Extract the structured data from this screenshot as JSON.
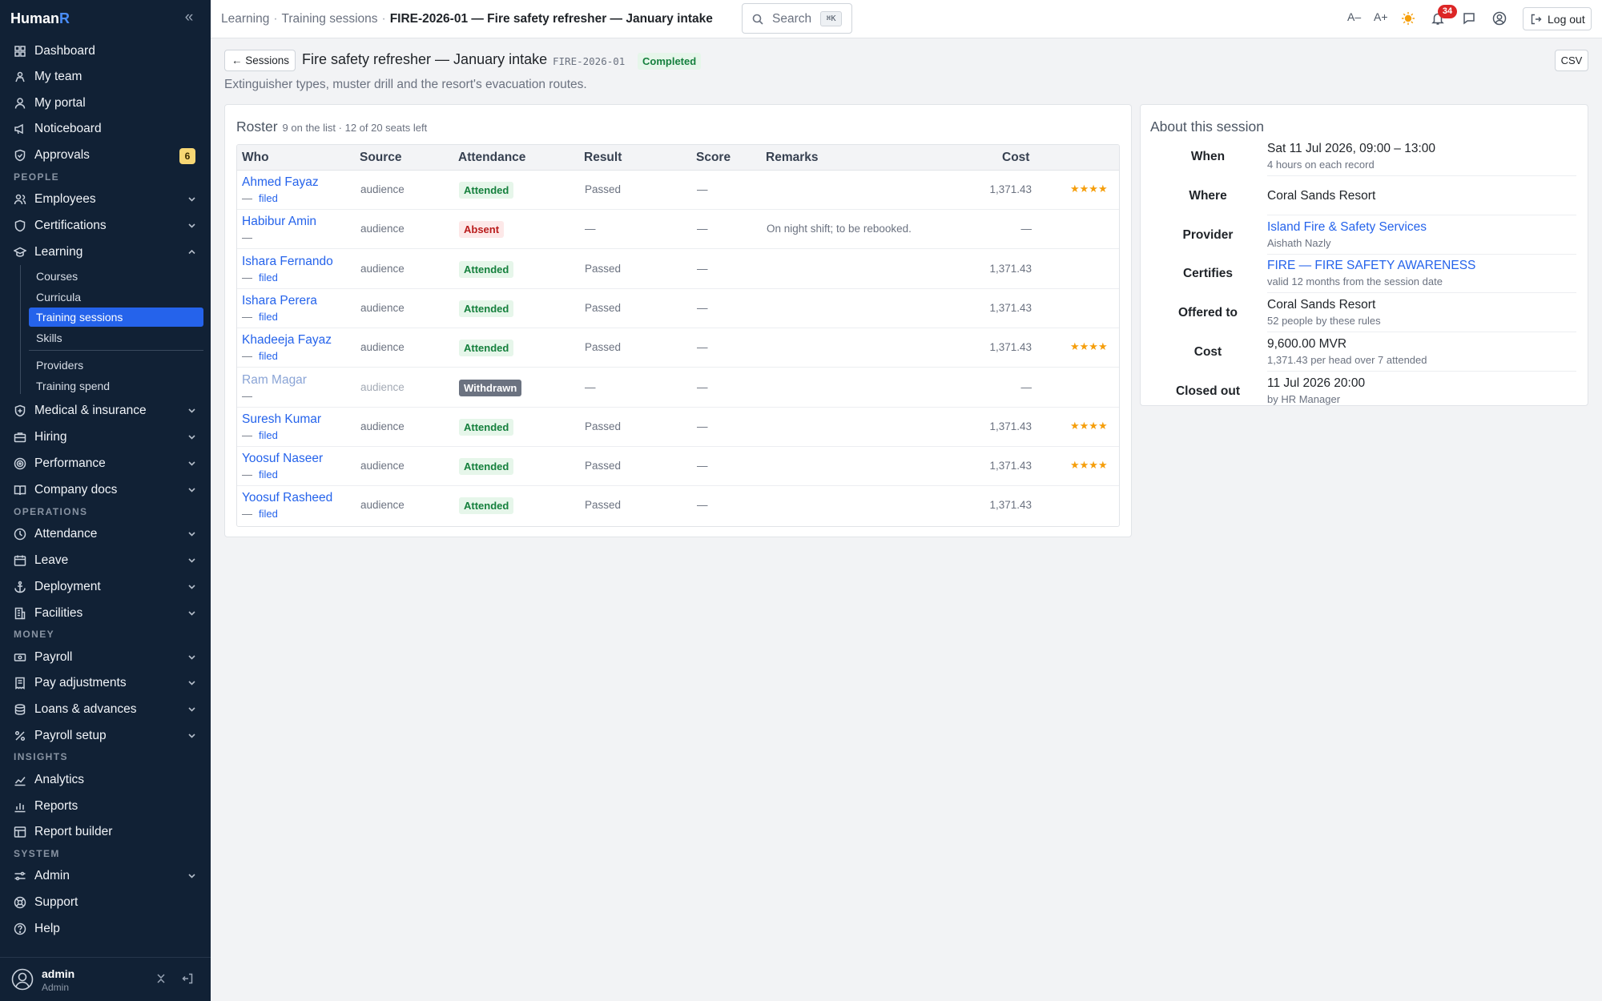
{
  "app": {
    "brand_main": "Human",
    "brand_accent": "R"
  },
  "sidebar": {
    "top_items": [
      {
        "label": "Dashboard",
        "icon": "grid-icon"
      },
      {
        "label": "My team",
        "icon": "team-icon"
      },
      {
        "label": "My portal",
        "icon": "user-icon"
      },
      {
        "label": "Noticeboard",
        "icon": "megaphone-icon"
      },
      {
        "label": "Approvals",
        "icon": "shield-check-icon",
        "badge": "6"
      }
    ],
    "sections": {
      "people": "PEOPLE",
      "operations": "OPERATIONS",
      "money": "MONEY",
      "insights": "INSIGHTS",
      "system": "SYSTEM"
    },
    "people_items": [
      {
        "label": "Employees"
      },
      {
        "label": "Certifications"
      },
      {
        "label": "Learning"
      }
    ],
    "learning_sub": [
      "Courses",
      "Curricula",
      "Training sessions",
      "Skills",
      "Providers",
      "Training spend"
    ],
    "people_items_after": [
      {
        "label": "Medical & insurance"
      },
      {
        "label": "Hiring"
      },
      {
        "label": "Performance"
      },
      {
        "label": "Company docs"
      }
    ],
    "operations_items": [
      {
        "label": "Attendance"
      },
      {
        "label": "Leave"
      },
      {
        "label": "Deployment"
      },
      {
        "label": "Facilities"
      }
    ],
    "money_items": [
      {
        "label": "Payroll"
      },
      {
        "label": "Pay adjustments"
      },
      {
        "label": "Loans & advances"
      },
      {
        "label": "Payroll setup"
      }
    ],
    "insights_items": [
      {
        "label": "Analytics"
      },
      {
        "label": "Reports"
      },
      {
        "label": "Report builder"
      }
    ],
    "system_items": [
      {
        "label": "Admin"
      },
      {
        "label": "Support"
      },
      {
        "label": "Help"
      }
    ],
    "user": {
      "name": "admin",
      "role": "Admin"
    }
  },
  "topbar": {
    "crumbs": [
      "Learning",
      "Training sessions",
      "FIRE-2026-01 — Fire safety refresher — January intake"
    ],
    "search_label": "Search",
    "search_kbd": "⌘K",
    "font_smaller": "A–",
    "font_larger": "A+",
    "notif_count": "34",
    "logout_label": "Log out"
  },
  "page": {
    "back_label": "Sessions",
    "title": "Fire safety refresher — January intake",
    "code": "FIRE-2026-01",
    "status": "Completed",
    "csv_label": "CSV",
    "description": "Extinguisher types, muster drill and the resort's evacuation routes."
  },
  "roster": {
    "title": "Roster",
    "subtitle": "9 on the list · 12 of 20 seats left",
    "columns": [
      "Who",
      "Source",
      "Attendance",
      "Result",
      "Score",
      "Remarks",
      "Cost"
    ],
    "rows": [
      {
        "name": "Ahmed Fayaz",
        "dash": "—",
        "filed": "filed",
        "source": "audience",
        "attendance": "Attended",
        "result": "Passed",
        "score": "—",
        "remarks": "",
        "cost": "1,371.43",
        "stars": "★★★★"
      },
      {
        "name": "Habibur Amin",
        "dash": "—",
        "filed": "",
        "source": "audience",
        "attendance": "Absent",
        "result": "—",
        "score": "—",
        "remarks": "On night shift; to be rebooked.",
        "cost": "—",
        "stars": ""
      },
      {
        "name": "Ishara Fernando",
        "dash": "—",
        "filed": "filed",
        "source": "audience",
        "attendance": "Attended",
        "result": "Passed",
        "score": "—",
        "remarks": "",
        "cost": "1,371.43",
        "stars": ""
      },
      {
        "name": "Ishara Perera",
        "dash": "—",
        "filed": "filed",
        "source": "audience",
        "attendance": "Attended",
        "result": "Passed",
        "score": "—",
        "remarks": "",
        "cost": "1,371.43",
        "stars": ""
      },
      {
        "name": "Khadeeja Fayaz",
        "dash": "—",
        "filed": "filed",
        "source": "audience",
        "attendance": "Attended",
        "result": "Passed",
        "score": "—",
        "remarks": "",
        "cost": "1,371.43",
        "stars": "★★★★"
      },
      {
        "name": "Ram Magar",
        "dash": "—",
        "filed": "",
        "source": "audience",
        "attendance": "Withdrawn",
        "result": "—",
        "score": "—",
        "remarks": "",
        "cost": "—",
        "stars": ""
      },
      {
        "name": "Suresh Kumar",
        "dash": "—",
        "filed": "filed",
        "source": "audience",
        "attendance": "Attended",
        "result": "Passed",
        "score": "—",
        "remarks": "",
        "cost": "1,371.43",
        "stars": "★★★★"
      },
      {
        "name": "Yoosuf Naseer",
        "dash": "—",
        "filed": "filed",
        "source": "audience",
        "attendance": "Attended",
        "result": "Passed",
        "score": "—",
        "remarks": "",
        "cost": "1,371.43",
        "stars": "★★★★"
      },
      {
        "name": "Yoosuf Rasheed",
        "dash": "—",
        "filed": "filed",
        "source": "audience",
        "attendance": "Attended",
        "result": "Passed",
        "score": "—",
        "remarks": "",
        "cost": "1,371.43",
        "stars": ""
      }
    ]
  },
  "about": {
    "title": "About this session",
    "items": [
      {
        "label": "When",
        "main": "Sat 11 Jul 2026, 09:00 – 13:00",
        "sub": "4 hours on each record",
        "link": false
      },
      {
        "label": "Where",
        "main": "Coral Sands Resort",
        "sub": "",
        "link": false
      },
      {
        "label": "Provider",
        "main": "Island Fire & Safety Services",
        "sub": "Aishath Nazly",
        "link": true
      },
      {
        "label": "Certifies",
        "main": "FIRE — FIRE SAFETY AWARENESS",
        "sub": "valid 12 months from the session date",
        "link": true
      },
      {
        "label": "Offered to",
        "main": "Coral Sands Resort",
        "sub": "52 people by these rules",
        "link": false
      },
      {
        "label": "Cost",
        "main": "9,600.00 MVR",
        "sub": "1,371.43 per head over 7 attended",
        "link": false
      },
      {
        "label": "Closed out",
        "main": "11 Jul 2026 20:00",
        "sub": "by HR Manager",
        "link": false
      }
    ]
  },
  "colors": {
    "sidebar_bg": "#112135",
    "accent": "#2563eb",
    "success": "#15803d",
    "danger": "#b91c1c",
    "star": "#f59e0b"
  }
}
